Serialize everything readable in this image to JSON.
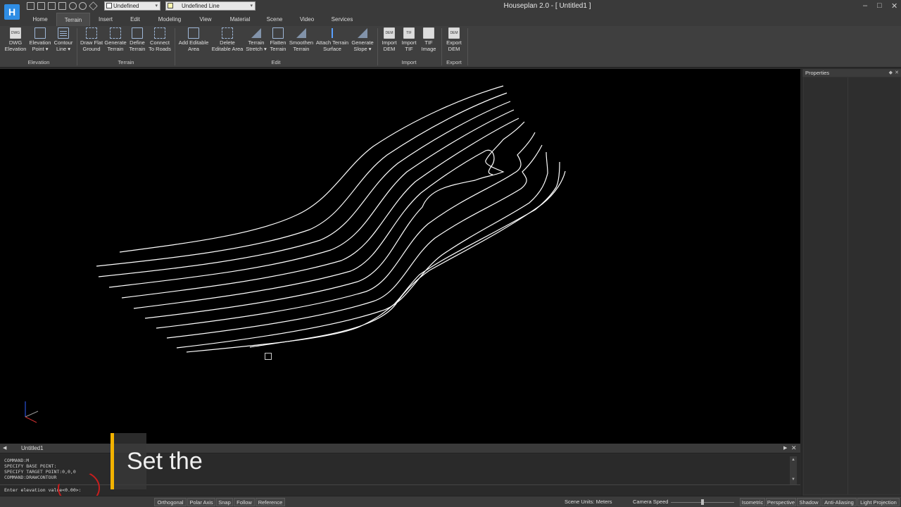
{
  "window": {
    "title": "Houseplan 2.0 -  [ Untitled1 ]",
    "logo": "H",
    "controls": [
      "minimize-icon",
      "maximize-icon",
      "close-icon"
    ]
  },
  "quick_access": {
    "icons": [
      "new-file-icon",
      "open-folder-icon",
      "save-icon",
      "save-as-icon",
      "undo-icon",
      "redo-icon",
      "layers-icon"
    ],
    "layer_combo": "Undefined",
    "line_combo": "Undefined Line"
  },
  "ribbon_tabs": [
    "Home",
    "Terrain",
    "Insert",
    "Edit",
    "Modeling",
    "View",
    "Material",
    "Scene",
    "Video",
    "Services"
  ],
  "active_tab": "Terrain",
  "ribbon": {
    "groups": [
      {
        "label": "Elevation",
        "buttons": [
          {
            "line1": "DWG",
            "line2": "Elevation",
            "icon": "dwg-elevation-icon"
          },
          {
            "line1": "Elevation",
            "line2": "Point ▾",
            "icon": "elevation-point-icon"
          },
          {
            "line1": "Contour",
            "line2": "Line ▾",
            "icon": "contour-line-icon"
          }
        ]
      },
      {
        "label": "Terrain",
        "buttons": [
          {
            "line1": "Draw Flat",
            "line2": "Ground",
            "icon": "draw-flat-ground-icon"
          },
          {
            "line1": "Generate",
            "line2": "Terrain",
            "icon": "generate-terrain-icon"
          },
          {
            "line1": "Define",
            "line2": "Terrain",
            "icon": "define-terrain-icon"
          },
          {
            "line1": "Connect",
            "line2": "To Roads",
            "icon": "connect-to-roads-icon"
          }
        ]
      },
      {
        "label": "Edit",
        "buttons": [
          {
            "line1": "Add Editable",
            "line2": "Area",
            "icon": "add-editable-area-icon"
          },
          {
            "line1": "Delete",
            "line2": "Editable Area",
            "icon": "delete-editable-area-icon"
          },
          {
            "line1": "Terrain",
            "line2": "Stretch ▾",
            "icon": "terrain-stretch-icon"
          },
          {
            "line1": "Flatten",
            "line2": "Terrain",
            "icon": "flatten-terrain-icon"
          },
          {
            "line1": "Smoothen",
            "line2": "Terrain",
            "icon": "smoothen-terrain-icon"
          },
          {
            "line1": "Attach Terrain",
            "line2": "Surface",
            "icon": "attach-terrain-surface-icon"
          },
          {
            "line1": "Generate",
            "line2": "Slope ▾",
            "icon": "generate-slope-icon"
          }
        ]
      },
      {
        "label": "Import",
        "buttons": [
          {
            "line1": "Import",
            "line2": "DEM",
            "icon": "import-dem-icon",
            "badge": "DEM"
          },
          {
            "line1": "Import",
            "line2": "TIF",
            "icon": "import-tif-icon",
            "badge": "TIF"
          },
          {
            "line1": "TIF",
            "line2": "Image",
            "icon": "tif-image-icon",
            "badge": ""
          }
        ]
      },
      {
        "label": "Export",
        "buttons": [
          {
            "line1": "Export",
            "line2": "DEM",
            "icon": "export-dem-icon",
            "badge": "DEM"
          }
        ]
      }
    ]
  },
  "properties_panel": {
    "title": "Properties"
  },
  "command": {
    "tab_name": "Untitled1",
    "log": [
      "COMMAND:M",
      "SPECIFY BASE POINT:",
      "SPECIFY TARGET POINT:0,0,0",
      "COMMAND:DRAWCONTOUR"
    ],
    "prompt": "Enter elevation value<0.00>:"
  },
  "caption": {
    "text": "Set the",
    "accent_color": "#f2b200"
  },
  "status_bar": {
    "left_toggles": [
      "Orthogonal",
      "Polar Axis",
      "Snap",
      "Follow",
      "Reference"
    ],
    "scene_units": "Scene Units: Meters",
    "camera_speed_label": "Camera Speed",
    "right_toggles": [
      "Isometric",
      "Perspective",
      "Shadow",
      "Anti-Aliasing",
      "Light Projection"
    ]
  },
  "colors": {
    "viewport": "#000000",
    "contour": "#ffffff",
    "annotation": "#c81e1e"
  }
}
